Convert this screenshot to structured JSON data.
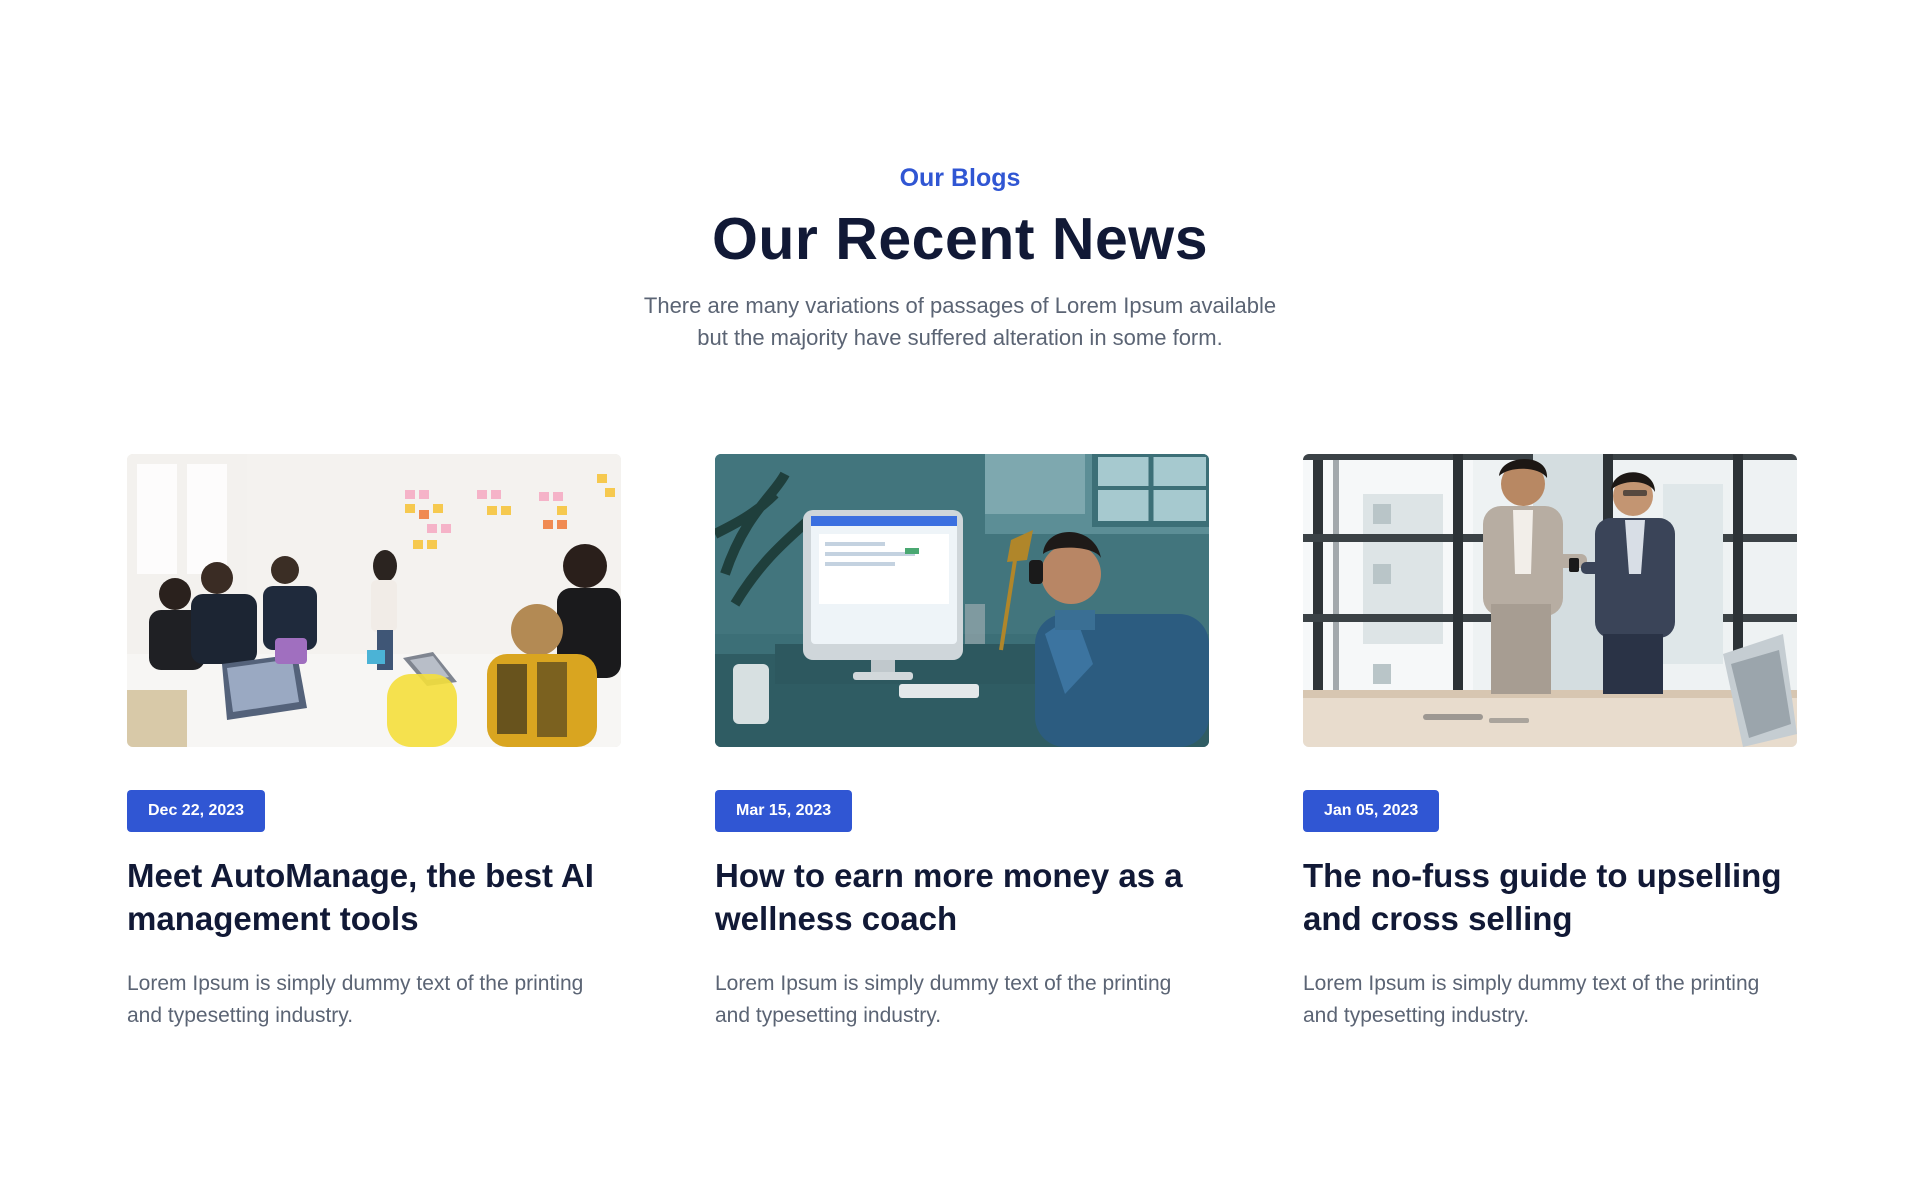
{
  "section": {
    "eyebrow": "Our Blogs",
    "title": "Our Recent News",
    "subtitle_line1": "There are many variations of passages of Lorem Ipsum available",
    "subtitle_line2": "but the majority have suffered alteration in some form."
  },
  "colors": {
    "accent": "#3056d3",
    "heading": "#111936",
    "body": "#5b6474",
    "background": "#ffffff"
  },
  "posts": [
    {
      "date": "Dec 22, 2023",
      "title": "Meet AutoManage, the best AI management tools",
      "excerpt": "Lorem Ipsum is simply dummy text of the printing and typesetting industry.",
      "image": "team-meeting-sticky-notes-photo"
    },
    {
      "date": "Mar 15, 2023",
      "title": "How to earn more money as a wellness coach",
      "excerpt": "Lorem Ipsum is simply dummy text of the printing and typesetting industry.",
      "image": "man-on-phone-at-desk-photo"
    },
    {
      "date": "Jan 05, 2023",
      "title": "The no-fuss guide to upselling and cross selling",
      "excerpt": "Lorem Ipsum is simply dummy text of the printing and typesetting industry.",
      "image": "two-businessmen-with-phone-photo"
    }
  ]
}
